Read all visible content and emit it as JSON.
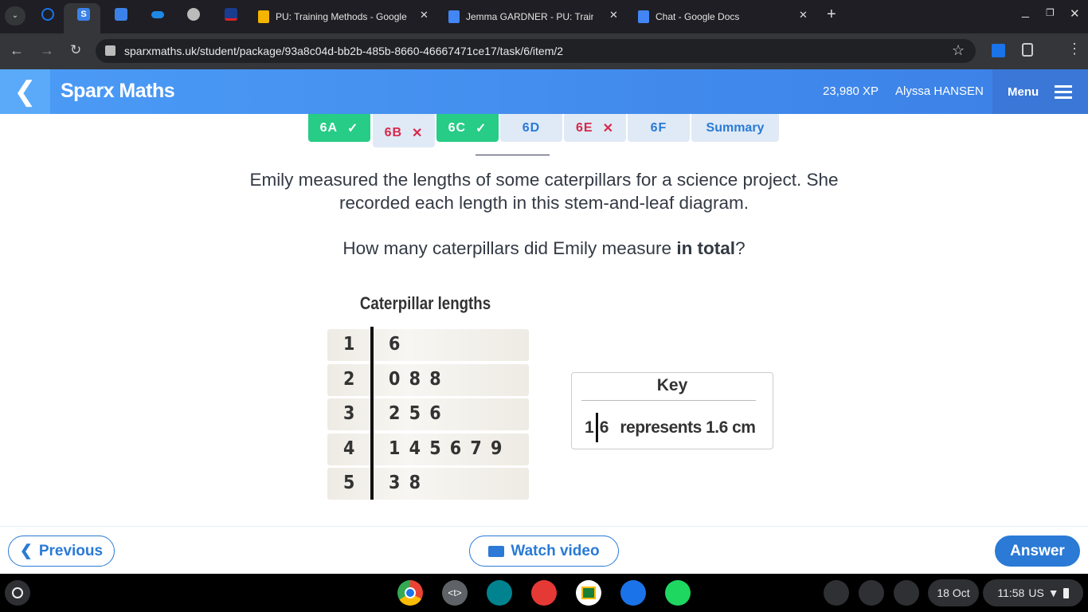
{
  "browser": {
    "tabs": [
      {
        "title": "PU: Training Methods - Google"
      },
      {
        "title": "Jemma GARDNER - PU: Training"
      },
      {
        "title": "Chat - Google Docs"
      }
    ],
    "url": "sparxmaths.uk/student/package/93a8c04d-bb2b-485b-8660-46667471ce17/task/6/item/2",
    "new_tab": "+"
  },
  "header": {
    "brand": "Sparx Maths",
    "xp": "23,980 XP",
    "user": "Alyssa HANSEN",
    "menu": "Menu"
  },
  "task_tabs": [
    {
      "label": "6A",
      "status": "correct"
    },
    {
      "label": "6B",
      "status": "incorrect"
    },
    {
      "label": "6C",
      "status": "correct"
    },
    {
      "label": "6D",
      "status": ""
    },
    {
      "label": "6E",
      "status": "incorrect"
    },
    {
      "label": "6F",
      "status": ""
    },
    {
      "label": "Summary",
      "status": ""
    }
  ],
  "question": {
    "line1": "Emily measured the lengths of some caterpillars for a science project. She",
    "line2": "recorded each length in this stem-and-leaf diagram.",
    "line3_pre": "How many caterpillars did Emily measure ",
    "line3_bold": "in total",
    "line3_post": "?"
  },
  "diagram": {
    "title": "Caterpillar lengths",
    "rows": [
      {
        "stem": "1",
        "leaves": "6"
      },
      {
        "stem": "2",
        "leaves": "0 8 8"
      },
      {
        "stem": "3",
        "leaves": "2 5 6"
      },
      {
        "stem": "4",
        "leaves": "1 4 5 6 7 9"
      },
      {
        "stem": "5",
        "leaves": "3 8"
      }
    ],
    "key": {
      "title": "Key",
      "stem": "1",
      "leaf": "6",
      "text": "represents 1.6 cm"
    }
  },
  "footer": {
    "previous": "Previous",
    "watch_video": "Watch video",
    "answer": "Answer"
  },
  "shelf": {
    "date": "18 Oct",
    "time": "11:58",
    "locale": "US"
  },
  "colors": {
    "accent": "#2a7ad6",
    "correct": "#27cc86",
    "incorrect": "#d6294a"
  }
}
